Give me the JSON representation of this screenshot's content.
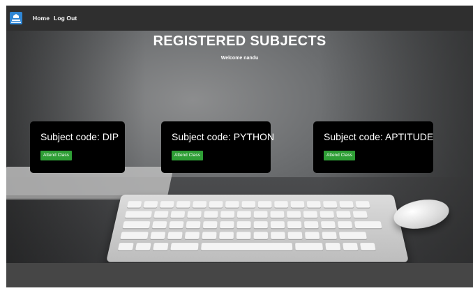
{
  "navbar": {
    "logo_icon": "school-logo-icon",
    "links": [
      {
        "label": "Home"
      },
      {
        "label": "Log Out"
      }
    ]
  },
  "page": {
    "title": "REGISTERED SUBJECTS",
    "welcome": "Welcome nandu"
  },
  "subjects": [
    {
      "title": "Subject code: DIP",
      "button": "Attend Class"
    },
    {
      "title": "Subject code: PYTHON",
      "button": "Attend Class"
    },
    {
      "title": "Subject code: APTITUDE",
      "button": "Attend Class"
    }
  ],
  "colors": {
    "navbar_bg": "#2f2f2f",
    "card_bg": "#000000",
    "button_bg": "#2e9e35",
    "logo_bg": "#2f86d4"
  }
}
